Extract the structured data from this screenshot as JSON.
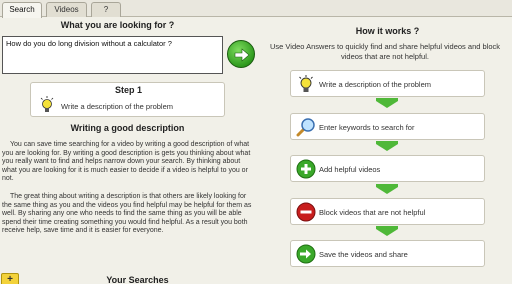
{
  "tabs": [
    {
      "label": "Search",
      "active": true
    },
    {
      "label": "Videos",
      "active": false
    },
    {
      "label": "?",
      "active": false
    }
  ],
  "left": {
    "title": "What you are looking for ?",
    "search_value": "How do you do long division without a calculator ?",
    "go_icon": "right-arrow-circle-icon",
    "step": {
      "title": "Step 1",
      "icon": "lightbulb-icon",
      "text": "Write a description of the problem"
    },
    "section_heading": "Writing a good description",
    "para1": "You can save time searching for a video by writing a good description of what you are looking for. By writing a good description is gets you thinking about what you really want to find and helps narrow down your search. By thinking about what you are looking for it is much easier to decide if a video is helpful to you or not.",
    "para2": "The great thing about writing a description is that others are likely looking for the same thing as you and the videos you find helpful may be helpful for them as well. By sharing any one who needs to find the same thing as you will be able spend their time creating something you would find helpful. As a result you both receive help, save time and it is easier for everyone.",
    "add_label": "+",
    "your_searches": "Your Searches"
  },
  "right": {
    "title": "How it works ?",
    "description": "Use Video Answers to quickly find and share helpful videos and block videos that are not helpful.",
    "steps": [
      {
        "icon": "lightbulb-icon",
        "label": "Write a description of the problem"
      },
      {
        "icon": "magnifier-icon",
        "label": "Enter keywords to search for"
      },
      {
        "icon": "plus-circle-icon",
        "label": "Add helpful videos"
      },
      {
        "icon": "minus-circle-icon",
        "label": "Block videos that are not helpful"
      },
      {
        "icon": "right-arrow-circle-icon",
        "label": "Save the videos and share"
      }
    ]
  },
  "colors": {
    "background": "#f1f0e8",
    "accent_green": "#2f9a1e",
    "block_red": "#c81e1e",
    "add_yellow": "#f3d23a"
  }
}
